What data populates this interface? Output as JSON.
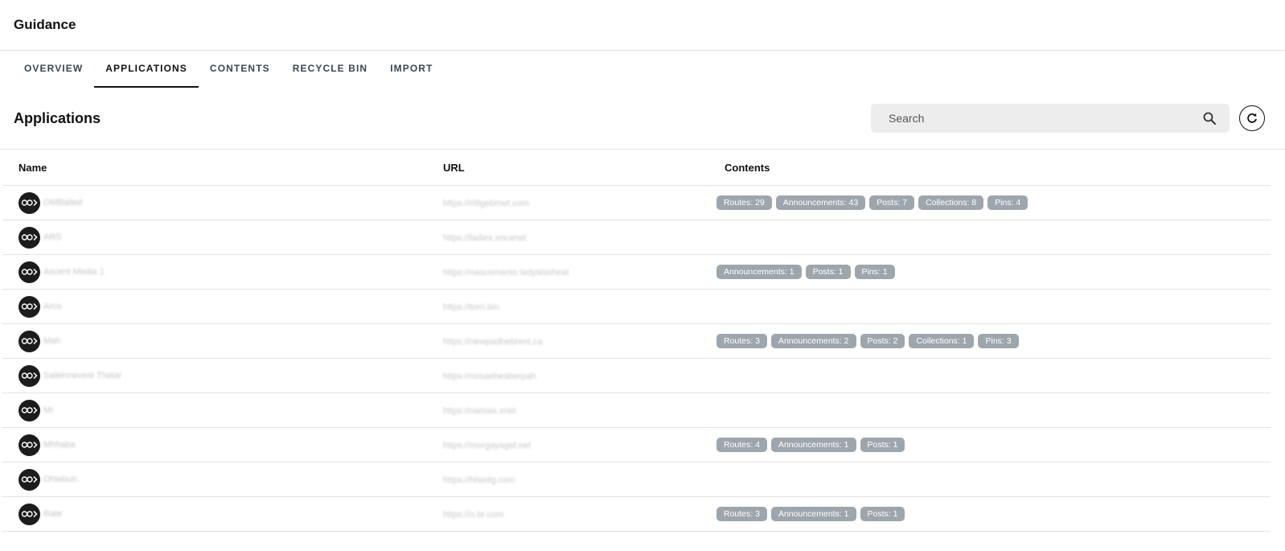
{
  "header": {
    "title": "Guidance"
  },
  "tabs": [
    {
      "label": "OVERVIEW",
      "active": false
    },
    {
      "label": "APPLICATIONS",
      "active": true
    },
    {
      "label": "CONTENTS",
      "active": false
    },
    {
      "label": "RECYCLE BIN",
      "active": false
    },
    {
      "label": "IMPORT",
      "active": false
    }
  ],
  "section": {
    "title": "Applications"
  },
  "search": {
    "placeholder": "Search",
    "value": ""
  },
  "icons": {
    "search": "search-icon",
    "refresh": "refresh-icon",
    "avatar": "app-logo-icon"
  },
  "colors": {
    "badge_bg": "#9ea6ad",
    "avatar_bg": "#1c1c1c",
    "active_tab": "#111111"
  },
  "table": {
    "columns": {
      "name": "Name",
      "url": "URL",
      "contents": "Contents"
    },
    "rows": [
      {
        "name": "OMBailed",
        "url": "https://rt8gebrnet.com",
        "badges": [
          "Routes: 29",
          "Announcements: 43",
          "Posts: 7",
          "Collections: 8",
          "Pins: 4"
        ]
      },
      {
        "name": "ARS",
        "url": "https://ladies.xncanet",
        "badges": []
      },
      {
        "name": "Ascent Media 1",
        "url": "https://nascoments.ladyslasheat",
        "badges": [
          "Announcements: 1",
          "Posts: 1",
          "Pins: 1"
        ]
      },
      {
        "name": "Arco",
        "url": "https://torn.bin",
        "badges": []
      },
      {
        "name": "Mah",
        "url": "https://newpadhebrent.ca",
        "badges": [
          "Routes: 3",
          "Announcements: 2",
          "Posts: 2",
          "Collections: 1",
          "Pins: 3"
        ]
      },
      {
        "name": "Saleinnevest Thatar",
        "url": "https://nosaebeaberpah",
        "badges": []
      },
      {
        "name": "Mr",
        "url": "https://naroas.xnet",
        "badges": []
      },
      {
        "name": "Mhhaba",
        "url": "https://morgayaget.net",
        "badges": [
          "Routes: 4",
          "Announcements: 1",
          "Posts: 1"
        ]
      },
      {
        "name": "Ohiebun",
        "url": "https://hlsedg.com",
        "badges": []
      },
      {
        "name": "Rate",
        "url": "https://n.br.com",
        "badges": [
          "Routes: 3",
          "Announcements: 1",
          "Posts: 1"
        ]
      }
    ]
  }
}
